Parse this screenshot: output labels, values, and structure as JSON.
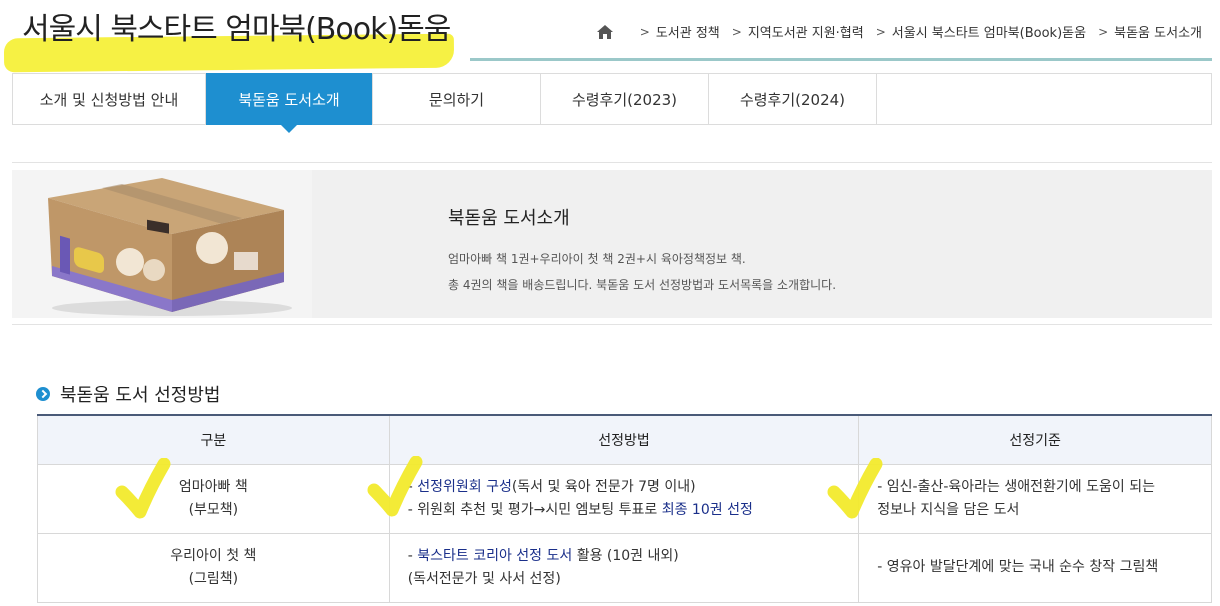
{
  "header": {
    "title": "서울시 북스타트 엄마북(Book)돋움",
    "breadcrumb": [
      "도서관 정책",
      "지역도서관 지원·협력",
      "서울시 북스타트 엄마북(Book)돋움",
      "북돋움 도서소개"
    ]
  },
  "tabs": [
    {
      "label": "소개 및 신청방법 안내"
    },
    {
      "label": "북돋움 도서소개"
    },
    {
      "label": "문의하기"
    },
    {
      "label": "수령후기(2023)"
    },
    {
      "label": "수령후기(2024)"
    }
  ],
  "intro": {
    "heading": "북돋움 도서소개",
    "line1": "엄마아빠 책 1권+우리아이 첫 책 2권+시 육아정책정보 책.",
    "line2": "총 4권의 책을 배송드립니다. 북돋움 도서 선정방법과 도서목록을 소개합니다."
  },
  "section": {
    "heading": "북돋움 도서 선정방법"
  },
  "table": {
    "headers": [
      "구분",
      "선정방법",
      "선정기준"
    ],
    "rows": [
      {
        "cat1": "엄마아빠 책",
        "cat2": "(부모책)",
        "m1_pre": "- ",
        "m1_hl": "선정위원회 구성",
        "m1_post": "(독서 및 육아 전문가 7명 이내)",
        "m2_pre": "- 위원회 추천 및 평가→시민 엠보팅 투표로 ",
        "m2_hl": "최종 10권 선정",
        "crit1": "- 임신-출산-육아라는 생애전환기에 도움이 되는",
        "crit2": "정보나 지식을 담은 도서"
      },
      {
        "cat1": "우리아이 첫 책",
        "cat2": "(그림책)",
        "m1_pre": "- ",
        "m1_hl": "북스타트 코리아 선정 도서",
        "m1_post": " 활용 (10권 내외)",
        "m2": "(독서전문가 및 사서 선정)",
        "crit1": "- 영유아 발달단계에 맞는 국내 순수 창작 그림책"
      }
    ]
  },
  "colors": {
    "accent": "#1e8fd0",
    "highlighter": "#f5f03a",
    "navy_text": "#1a2f8a",
    "title_rule": "#9bc8c9"
  }
}
